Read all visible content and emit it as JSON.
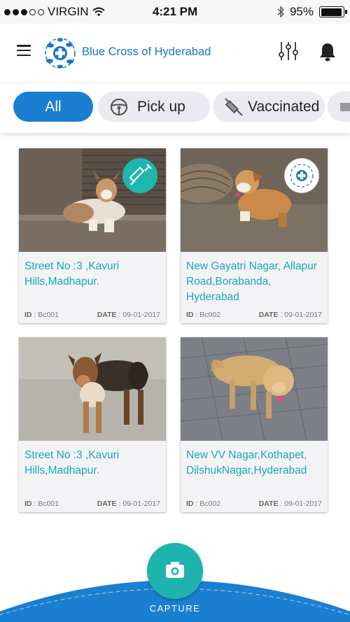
{
  "status_bar": {
    "carrier": "VIRGIN",
    "time": "4:21 PM",
    "battery": "95%",
    "battery_level": 0.95
  },
  "header": {
    "title": "Blue Cross of Hyderabad"
  },
  "filters": [
    {
      "label": "All",
      "active": true
    },
    {
      "label": "Pick up",
      "icon": "steering-wheel-icon"
    },
    {
      "label": "Vaccinated",
      "icon": "syringe-icon"
    },
    {
      "label": "",
      "icon": "truck-icon"
    }
  ],
  "cards": [
    {
      "address": "Street No :3 ,Kavuri Hills,Madhapur.",
      "id_label": "ID",
      "id": "Bc001",
      "date_label": "DATE",
      "date": "09-01-2017",
      "badge": "syringe-icon",
      "photo": "dog-lying-on-ledge"
    },
    {
      "address": "New Gayatri Nagar, Allapur Road,Borabanda, Hyderabad",
      "id_label": "ID",
      "id": "Bc002",
      "date_label": "DATE",
      "date": "09-01-2017",
      "badge": "blue-cross-logo-icon",
      "photo": "puppy-by-basket"
    },
    {
      "address": "Street No :3 ,Kavuri Hills,Madhapur.",
      "id_label": "ID",
      "id": "Bc001",
      "date_label": "DATE",
      "date": "09-01-2017",
      "photo": "dog-standing"
    },
    {
      "address": "New VV Nagar,Kothapet, DilshukNagar,Hyderabad",
      "id_label": "ID",
      "id": "Bc002",
      "date_label": "DATE",
      "date": "09-01-2017",
      "photo": "fluffy-dog-on-pavement"
    }
  ],
  "capture": {
    "label": "CAPTURE"
  },
  "colors": {
    "primary_blue": "#1a7fd0",
    "teal": "#1fb3ad",
    "address_teal": "#17a8b6",
    "chip_bg": "#ebeaf0"
  }
}
